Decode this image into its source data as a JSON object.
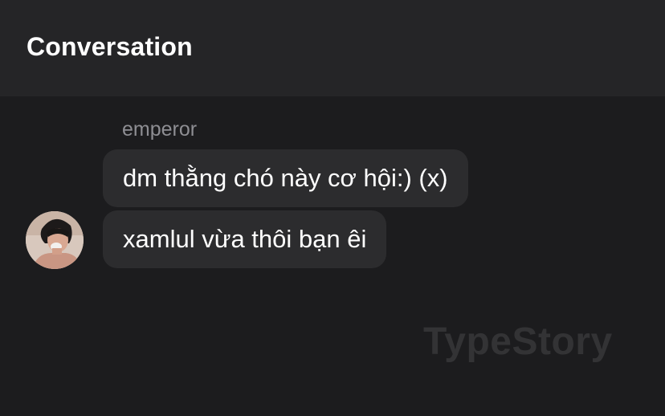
{
  "header": {
    "title": "Conversation"
  },
  "conversation": {
    "sender_name": "emperor",
    "avatar_icon": "user-avatar-photo",
    "messages": [
      {
        "text": "dm thằng chó này cơ hội:) (x)"
      },
      {
        "text": "xamlul vừa thôi bạn êi"
      }
    ]
  },
  "watermark": {
    "text": "TypeStory"
  },
  "colors": {
    "background": "#1c1c1e",
    "header_background": "#252527",
    "bubble_background": "#2c2c2e",
    "sender_text": "#8e8e93",
    "message_text": "#ffffff"
  }
}
